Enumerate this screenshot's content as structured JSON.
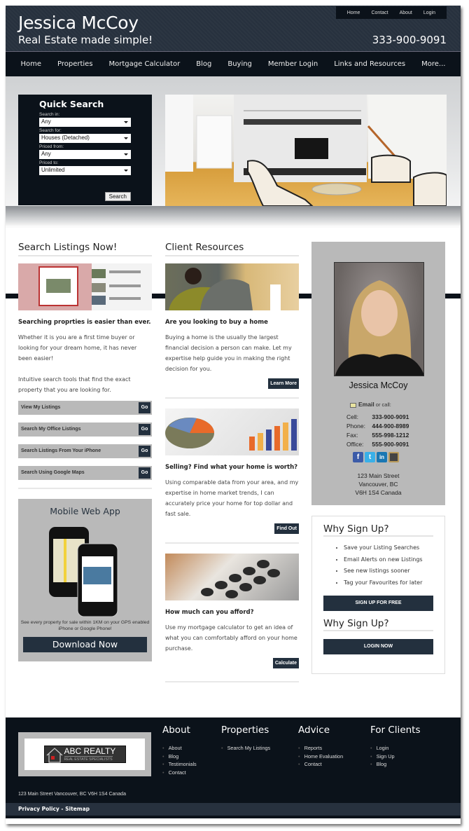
{
  "header": {
    "title": "Jessica McCoy",
    "tagline": "Real Estate made simple!",
    "phone": "333-900-9091",
    "top_nav": [
      "Home",
      "Contact",
      "About",
      "Login"
    ],
    "main_nav": [
      "Home",
      "Properties",
      "Mortgage Calculator",
      "Blog",
      "Buying",
      "Member Login",
      "Links and Resources",
      "More..."
    ]
  },
  "quick_search": {
    "title": "Quick Search",
    "fields": [
      {
        "label": "Search in:",
        "value": "Any"
      },
      {
        "label": "Search for:",
        "value": "Houses (Detached)"
      },
      {
        "label": "Priced from:",
        "value": "Any"
      },
      {
        "label": "Priced to:",
        "value": "Unlimited"
      }
    ],
    "button": "Search"
  },
  "search_listings": {
    "title": "Search Listings Now!",
    "heading": "Searching proprties is easier than ever.",
    "para1": "Whether it is you are a first time buyer or looking for your dream home, it has never been easier!",
    "para2": "Intuitive search tools that find the exact property that you are looking for.",
    "links": [
      "View My Listings",
      "Search My Office Listings",
      "Search Listings From Your iPhone",
      "Search Using Google Maps"
    ],
    "go_label": "Go"
  },
  "mobile_app": {
    "title": "Mobile Web App",
    "caption": "See every property for sale within 1KM on your GPS enabled iPhone or Google Phone!",
    "button": "Download Now"
  },
  "client_resources": {
    "title": "Client Resources",
    "items": [
      {
        "heading": "Are you looking to buy a home",
        "text": "Buying a home is the usually the largest financial decision a person can make. Let my expertise help guide you in making the right decision for you.",
        "button": "Learn More"
      },
      {
        "heading": "Selling? Find what your home is worth?",
        "text": "Using comparable data from your area, and my expertise in home market trends, I can accurately price your home for top dollar and fast sale.",
        "button": "Find Out"
      },
      {
        "heading": "How much can you afford?",
        "text": "Use my mortgage calculator to get an idea of what you can comfortably afford on your home purchase.",
        "button": "Calculate"
      }
    ]
  },
  "agent": {
    "name": "Jessica McCoy",
    "email_label": "Email",
    "email_suffix": "or call:",
    "contacts": [
      {
        "label": "Cell:",
        "value": "333-900-9091"
      },
      {
        "label": "Phone:",
        "value": "444-900-8989"
      },
      {
        "label": "Fax:",
        "value": "555-998-1212"
      },
      {
        "label": "Office:",
        "value": "555-900-9091"
      }
    ],
    "social": [
      "f",
      "t",
      "in",
      ""
    ],
    "address": [
      "123 Main Street",
      "Vancouver, BC",
      "V6H 1S4 Canada"
    ]
  },
  "signup": {
    "title": "Why Sign Up?",
    "benefits": [
      "Save your Listing Searches",
      "Email Alerts on new Listings",
      "See new listings sooner",
      "Tag your Favourites for later"
    ],
    "signup_button": "SIGN UP FOR FREE",
    "title2": "Why Sign Up?",
    "login_button": "LOGIN NOW"
  },
  "footer": {
    "logo_title": "ABC REALTY",
    "logo_sub": "REAL ESTATE SPECIALISTS",
    "columns": [
      {
        "title": "About",
        "links": [
          "About",
          "Blog",
          "Testimonials",
          "Contact"
        ]
      },
      {
        "title": "Properties",
        "links": [
          "Search My Listings"
        ]
      },
      {
        "title": "Advice",
        "links": [
          "Reports",
          "Home Evaluation",
          "Contact"
        ]
      },
      {
        "title": "For Clients",
        "links": [
          "Login",
          "Sign Up",
          "Blog"
        ]
      }
    ],
    "address": "123 Main Street Vancouver, BC V6H 1S4 Canada",
    "privacy": "Privacy Policy",
    "dash": " - ",
    "sitemap": "Sitemap"
  }
}
